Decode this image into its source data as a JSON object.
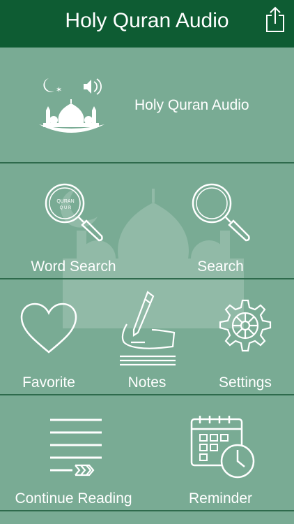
{
  "header": {
    "title": "Holy Quran Audio"
  },
  "banner": {
    "label": "Holy Quran Audio"
  },
  "menu": {
    "word_search": "Word Search",
    "search": "Search",
    "favorite": "Favorite",
    "notes": "Notes",
    "settings": "Settings",
    "continue_reading": "Continue Reading",
    "reminder": "Reminder",
    "quran_lens_text": "QURAN"
  },
  "colors": {
    "header": "#0e5c33",
    "background": "#79ab94",
    "divider": "#2e6a4c",
    "icon": "#ffffff"
  }
}
